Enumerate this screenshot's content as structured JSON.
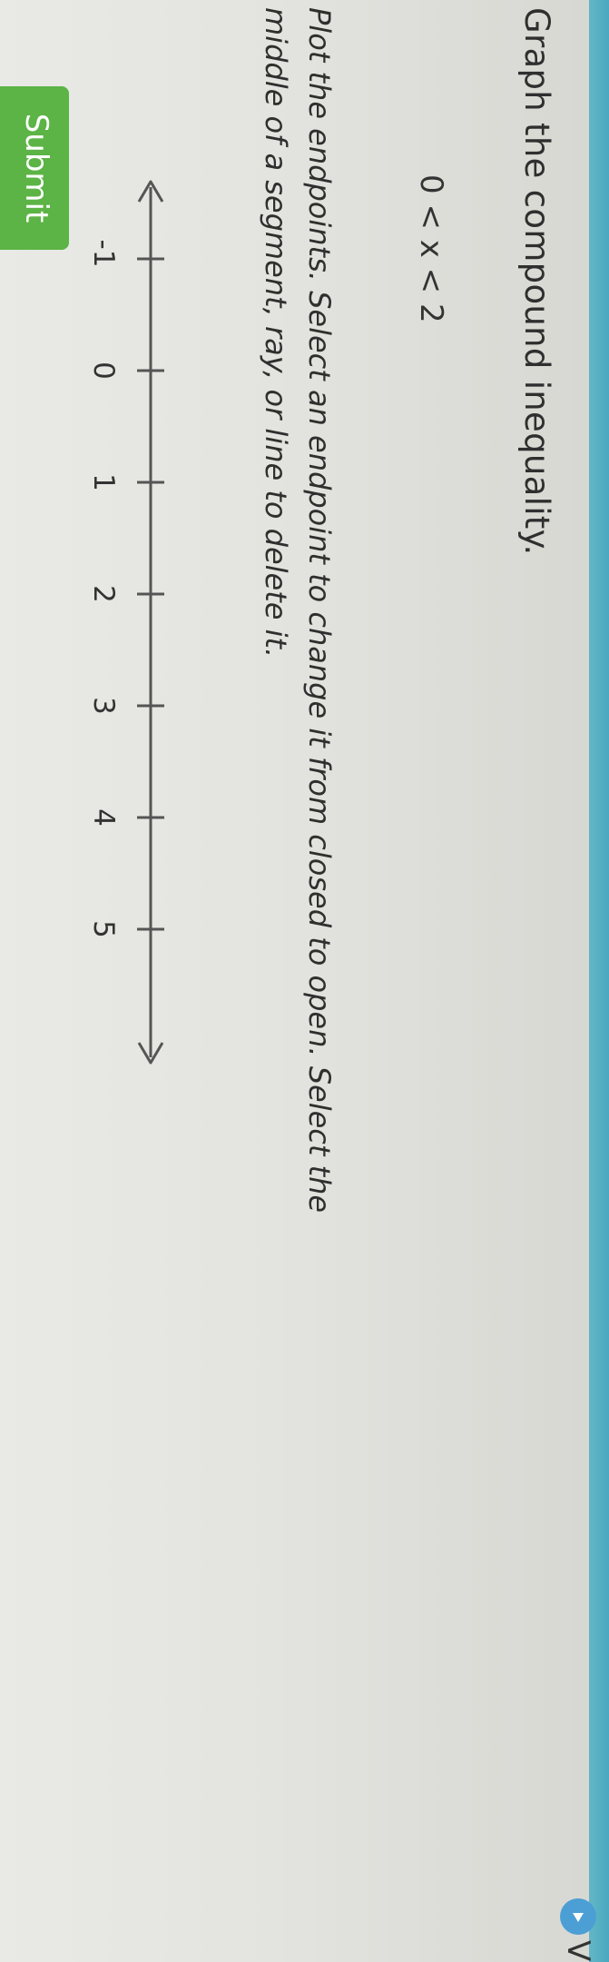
{
  "question": {
    "title": "Graph the compound inequality.",
    "expression": "0 < x < 2",
    "instructions": "Plot the endpoints. Select an endpoint to change it from closed to open. Select the middle of a segment, ray, or line to delete it."
  },
  "number_line": {
    "ticks": [
      "-1",
      "0",
      "1",
      "2",
      "3",
      "4",
      "5"
    ],
    "min": -1,
    "max": 5,
    "arrows": "both",
    "line_color": "#555555"
  },
  "buttons": {
    "submit_label": "Submit",
    "video_label": "Vi"
  },
  "colors": {
    "submit_bg": "#5bb445",
    "video_icon_bg": "#4b9fd5",
    "top_bar": "#4aa8bf"
  },
  "icons": {
    "video": "play-icon",
    "cursor": "hand-cursor-icon"
  }
}
